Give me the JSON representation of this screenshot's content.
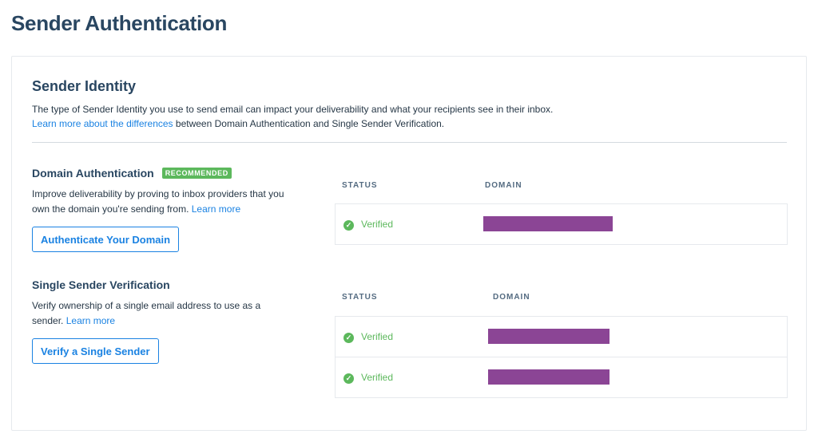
{
  "page": {
    "title": "Sender Authentication"
  },
  "identity": {
    "title": "Sender Identity",
    "intro_line1": "The type of Sender Identity you use to send email can impact your deliverability and what your recipients see in their inbox.",
    "intro_link": "Learn more about the differences",
    "intro_line2_rest": " between Domain Authentication and Single Sender Verification."
  },
  "domain_auth": {
    "title": "Domain Authentication",
    "badge": "RECOMMENDED",
    "description": "Improve deliverability by proving to inbox providers that you own the domain you're sending from.",
    "learn_more": "Learn more",
    "button": "Authenticate Your Domain",
    "table": {
      "headers": {
        "status": "STATUS",
        "domain": "DOMAIN"
      },
      "rows": [
        {
          "status": "Verified",
          "domain_redacted": true
        }
      ]
    }
  },
  "single_sender": {
    "title": "Single Sender Verification",
    "description": "Verify ownership of a single email address to use as a sender.",
    "learn_more": "Learn more",
    "button": "Verify a Single Sender",
    "table": {
      "headers": {
        "status": "STATUS",
        "domain": "DOMAIN"
      },
      "rows": [
        {
          "status": "Verified",
          "domain_redacted": true
        },
        {
          "status": "Verified",
          "domain_redacted": true
        }
      ]
    }
  },
  "colors": {
    "accent": "#1a82e2",
    "success": "#5cb85c",
    "heading": "#294661",
    "redaction": "#8b4595"
  },
  "icons": {
    "verified": "check-circle-icon"
  }
}
